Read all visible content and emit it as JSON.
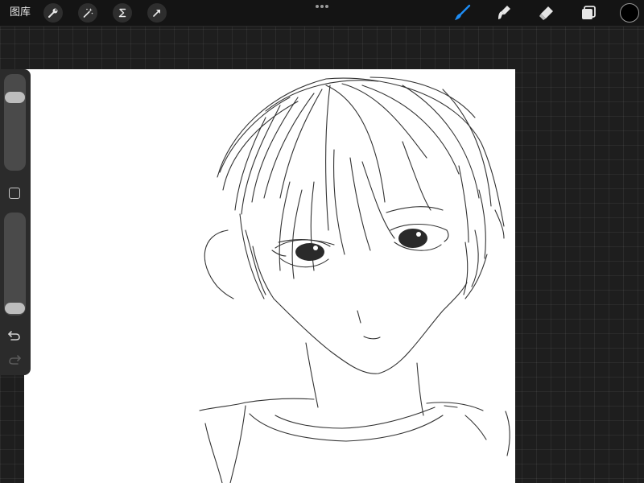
{
  "topbar": {
    "gallery_label": "图库",
    "tools": [
      "wrench-icon",
      "magic-wand-icon",
      "selection-icon",
      "transform-arrow-icon"
    ],
    "brush_tool": "brush-icon",
    "smudge_tool": "smudge-icon",
    "eraser_tool": "eraser-icon",
    "layers_tool": "layers-icon",
    "active_color": "#000000",
    "accent_color": "#1e8df5"
  },
  "sidebar": {
    "brush_size_level": 0.8,
    "opacity_level": 0.0,
    "undo_icon": "undo-icon",
    "redo_icon": "redo-icon"
  }
}
